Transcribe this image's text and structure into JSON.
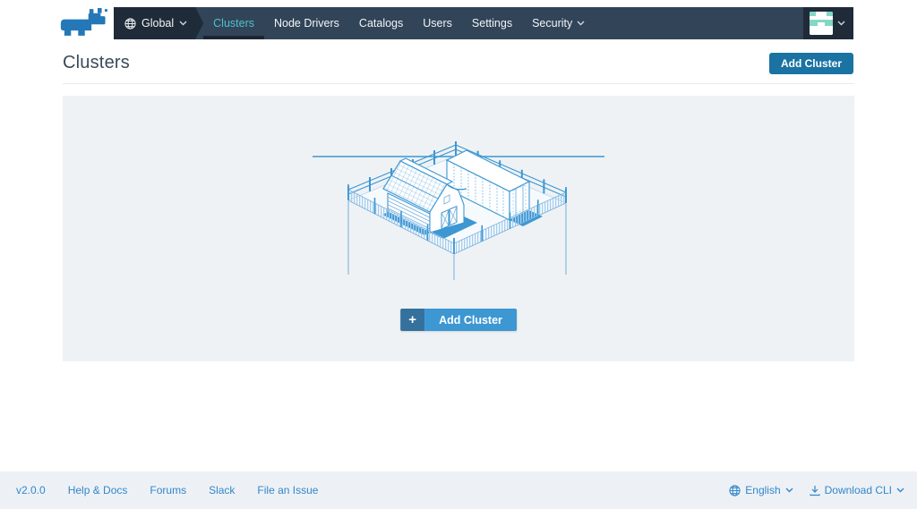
{
  "header": {
    "global_label": "Global",
    "nav_items": [
      {
        "label": "Clusters"
      },
      {
        "label": "Node Drivers"
      },
      {
        "label": "Catalogs"
      },
      {
        "label": "Users"
      },
      {
        "label": "Settings"
      },
      {
        "label": "Security"
      }
    ]
  },
  "page": {
    "title": "Clusters",
    "add_button_label": "Add Cluster"
  },
  "empty_state": {
    "plus": "+",
    "button_label": "Add Cluster"
  },
  "footer": {
    "version": "v2.0.0",
    "links": [
      {
        "label": "Help & Docs"
      },
      {
        "label": "Forums"
      },
      {
        "label": "Slack"
      },
      {
        "label": "File an Issue"
      }
    ],
    "language": "English",
    "download_cli": "Download CLI"
  },
  "colors": {
    "navbar": "#324458",
    "navbar_dark": "#1f2b38",
    "active_teal": "#4ec2cc",
    "primary_button": "#1a73a2",
    "split_button": "#3c97d3",
    "split_button_dark": "#35719d",
    "link_blue": "#3287c8",
    "logo_blue": "#2478b8",
    "illustration_blue": "#3c97d3"
  }
}
